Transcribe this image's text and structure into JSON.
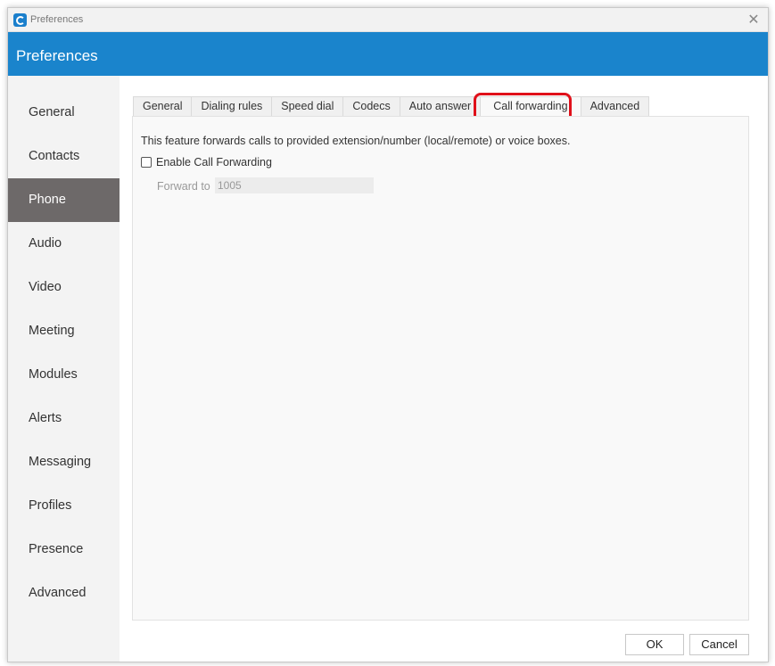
{
  "window": {
    "title": "Preferences"
  },
  "header": {
    "title": "Preferences"
  },
  "sidebar": {
    "items": [
      {
        "label": "General"
      },
      {
        "label": "Contacts"
      },
      {
        "label": "Phone",
        "active": true
      },
      {
        "label": "Audio"
      },
      {
        "label": "Video"
      },
      {
        "label": "Meeting"
      },
      {
        "label": "Modules"
      },
      {
        "label": "Alerts"
      },
      {
        "label": "Messaging"
      },
      {
        "label": "Profiles"
      },
      {
        "label": "Presence"
      },
      {
        "label": "Advanced"
      }
    ]
  },
  "tabs": [
    {
      "label": "General"
    },
    {
      "label": "Dialing rules"
    },
    {
      "label": "Speed dial"
    },
    {
      "label": "Codecs"
    },
    {
      "label": "Auto answer"
    },
    {
      "label": "Call forwarding",
      "active": true
    },
    {
      "label": "Advanced"
    }
  ],
  "panel": {
    "description": "This feature forwards calls to provided extension/number (local/remote) or voice boxes.",
    "enable_label": "Enable Call Forwarding",
    "enable_checked": false,
    "forward_label": "Forward to",
    "forward_value": "1005"
  },
  "buttons": {
    "ok": "OK",
    "cancel": "Cancel"
  },
  "colors": {
    "header": "#1a84cc",
    "active_sidebar": "#6d6969",
    "highlight": "#e0101a"
  },
  "icons": {
    "app": "app-logo-icon",
    "close": "close-icon"
  }
}
